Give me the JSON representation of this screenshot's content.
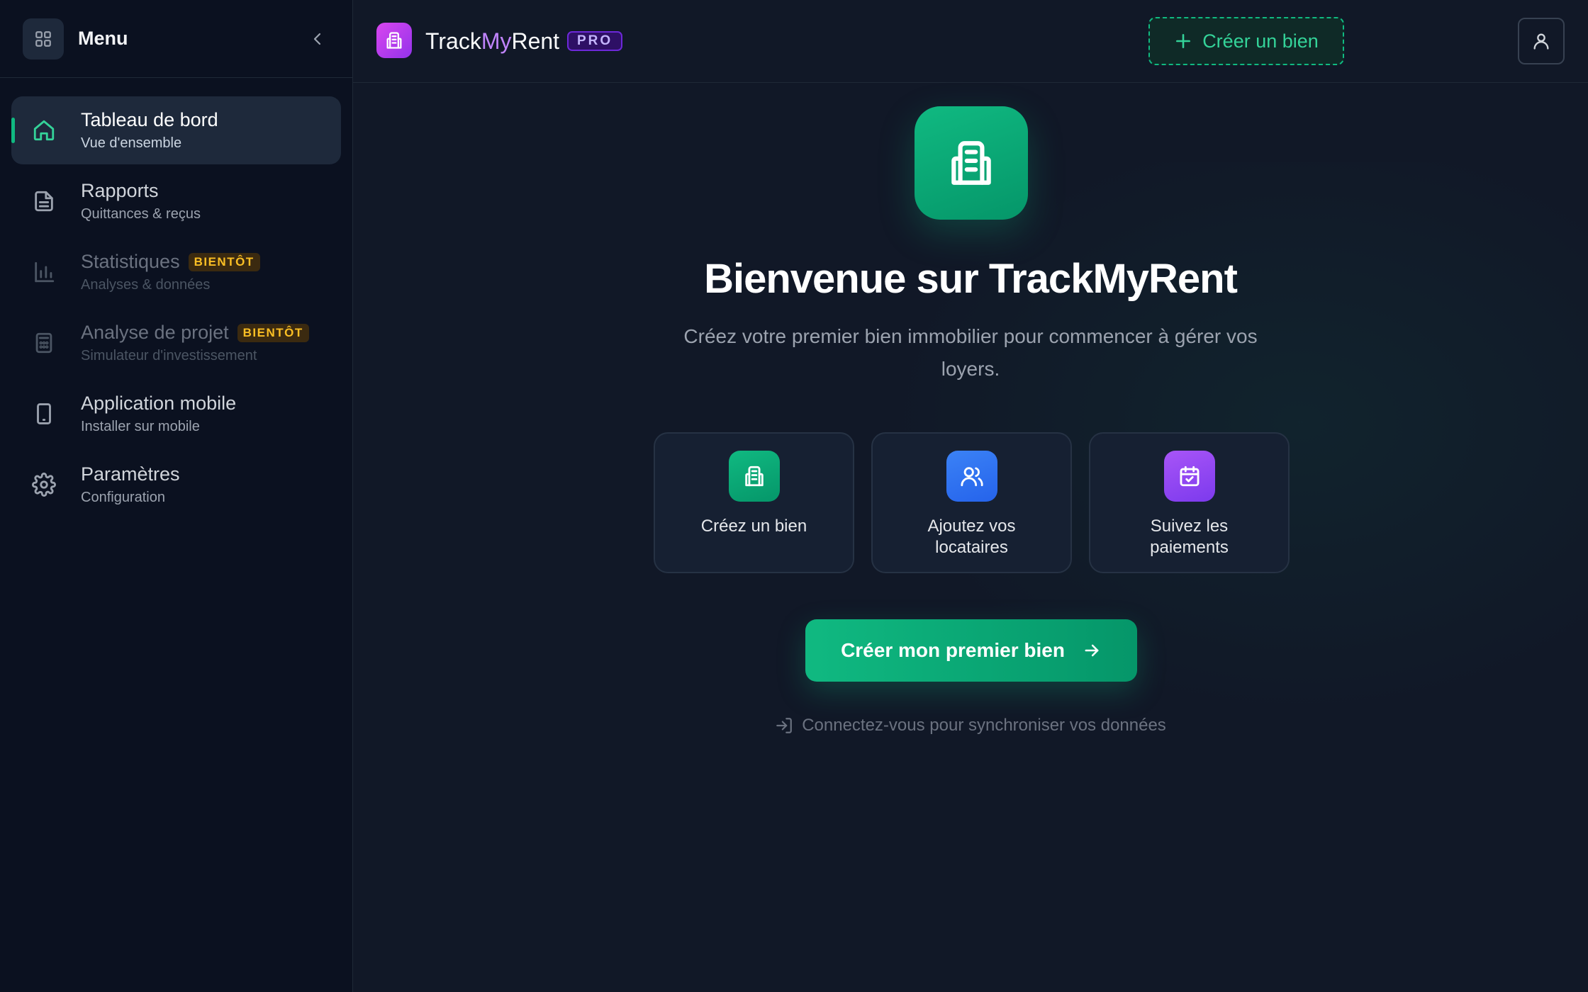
{
  "sidebar": {
    "title": "Menu",
    "items": [
      {
        "label": "Tableau de bord",
        "sub": "Vue d'ensemble",
        "active": true
      },
      {
        "label": "Rapports",
        "sub": "Quittances & reçus"
      },
      {
        "label": "Statistiques",
        "sub": "Analyses & données",
        "badge": "BIENTÔT"
      },
      {
        "label": "Analyse de projet",
        "sub": "Simulateur d'investissement",
        "badge": "BIENTÔT"
      },
      {
        "label": "Application mobile",
        "sub": "Installer sur mobile"
      },
      {
        "label": "Paramètres",
        "sub": "Configuration"
      }
    ]
  },
  "header": {
    "brand_part1": "Track",
    "brand_part2": "My",
    "brand_part3": "Rent",
    "pro_badge": "PRO",
    "create_button": "Créer un bien"
  },
  "main": {
    "title": "Bienvenue sur TrackMyRent",
    "subtitle": "Créez votre premier bien immobilier pour commencer à gérer vos loyers.",
    "cards": [
      {
        "label": "Créez un bien",
        "icon": "building-icon"
      },
      {
        "label": "Ajoutez vos locataires",
        "icon": "users-icon"
      },
      {
        "label": "Suivez les paiements",
        "icon": "calendar-check-icon"
      }
    ],
    "cta": "Créer mon premier bien",
    "login_hint": "Connectez-vous pour synchroniser vos données"
  },
  "colors": {
    "accent": "#10b981",
    "brand_purple": "#c084fc",
    "badge_soon": "#fbbf24",
    "background": "#111827",
    "sidebar_bg": "#0b1120"
  }
}
